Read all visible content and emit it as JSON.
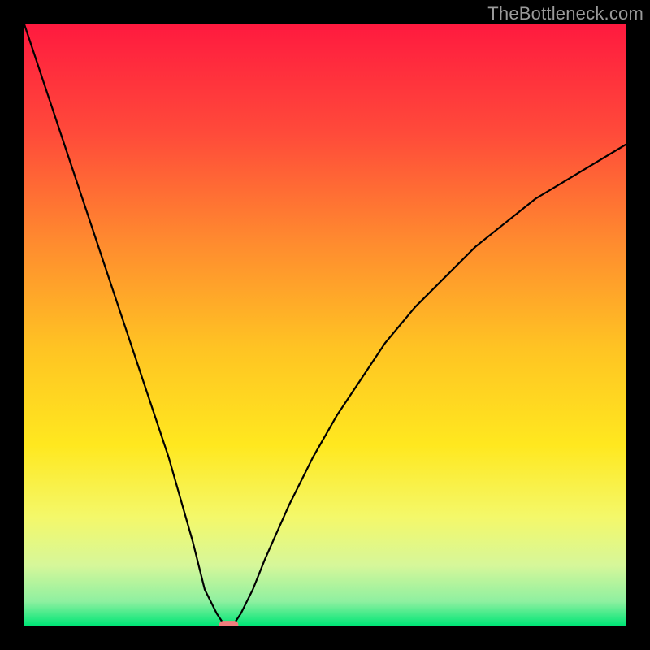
{
  "watermark": "TheBottleneck.com",
  "chart_data": {
    "type": "line",
    "title": "",
    "xlabel": "",
    "ylabel": "",
    "xlim": [
      0,
      100
    ],
    "ylim": [
      0,
      100
    ],
    "grid": false,
    "legend": false,
    "background_gradient": {
      "orientation": "vertical",
      "stops": [
        {
          "pos": 0.0,
          "color": "#ff1a3f"
        },
        {
          "pos": 0.18,
          "color": "#ff4a3a"
        },
        {
          "pos": 0.36,
          "color": "#ff8a2f"
        },
        {
          "pos": 0.54,
          "color": "#ffc423"
        },
        {
          "pos": 0.7,
          "color": "#ffe81f"
        },
        {
          "pos": 0.82,
          "color": "#f4f86a"
        },
        {
          "pos": 0.9,
          "color": "#d6f79a"
        },
        {
          "pos": 0.96,
          "color": "#8ef0a0"
        },
        {
          "pos": 1.0,
          "color": "#00e676"
        }
      ]
    },
    "series": [
      {
        "name": "bottleneck-curve",
        "color": "#000000",
        "x": [
          0,
          4,
          8,
          12,
          16,
          20,
          24,
          28,
          30,
          32,
          33,
          34,
          35,
          36,
          38,
          40,
          44,
          48,
          52,
          56,
          60,
          65,
          70,
          75,
          80,
          85,
          90,
          95,
          100
        ],
        "y": [
          100,
          88,
          76,
          64,
          52,
          40,
          28,
          14,
          6,
          2,
          0.5,
          0,
          0.5,
          2,
          6,
          11,
          20,
          28,
          35,
          41,
          47,
          53,
          58,
          63,
          67,
          71,
          74,
          77,
          80
        ]
      }
    ],
    "markers": [
      {
        "name": "minimum-pill",
        "x": 34,
        "y": 0,
        "color": "#f27d7d",
        "shape": "rounded-rect",
        "w": 3.2,
        "h": 1.6
      }
    ]
  }
}
